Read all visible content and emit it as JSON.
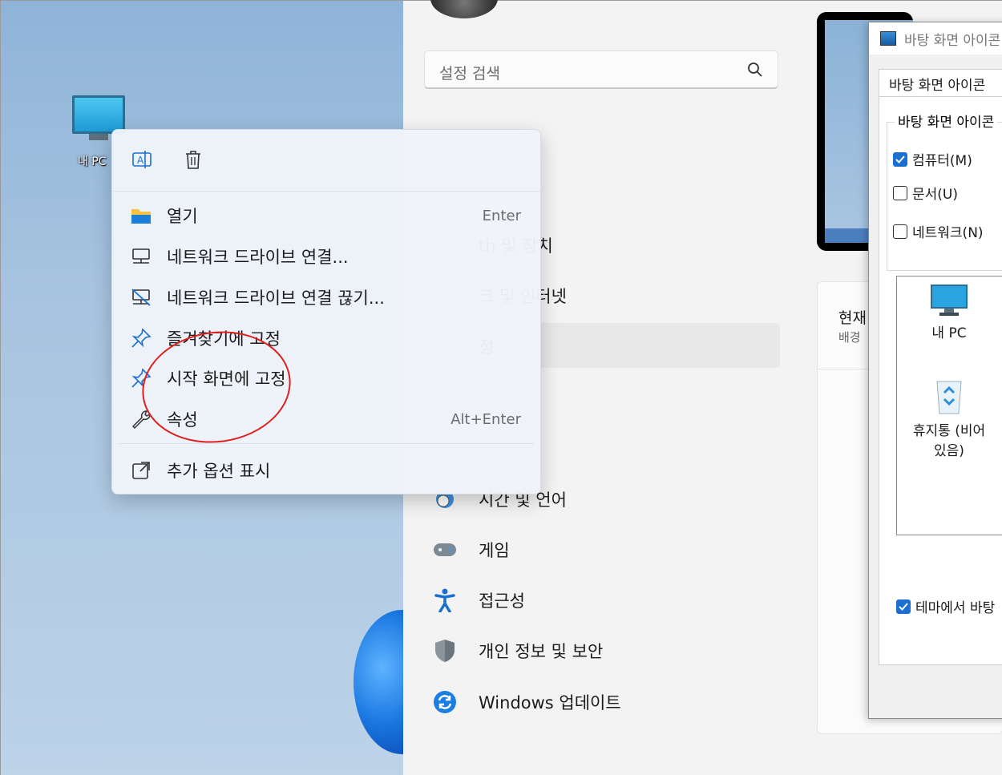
{
  "desktop": {
    "icon_label": "내 PC"
  },
  "settings": {
    "search_placeholder": "설정 검색",
    "nav": [
      {
        "label": "th 및 장치",
        "icon": "bluetooth-icon"
      },
      {
        "label": "크 및 인터넷",
        "icon": "network-icon"
      },
      {
        "label": "정",
        "icon": "personalization-icon"
      },
      {
        "label": "시간 및 언어",
        "icon": "time-language-icon"
      },
      {
        "label": "게임",
        "icon": "gaming-icon"
      },
      {
        "label": "접근성",
        "icon": "accessibility-icon"
      },
      {
        "label": "개인 정보 및 보안",
        "icon": "shield-icon"
      },
      {
        "label": "Windows 업데이트",
        "icon": "update-icon"
      }
    ],
    "card_title": "현재",
    "card_subtitle": "배경"
  },
  "dialog": {
    "title": "바탕 화면 아이콘",
    "tab": "바탕 화면 아이콘",
    "group_title": "바탕 화면 아이콘",
    "checkboxes": [
      {
        "label": "컴퓨터(M)",
        "checked": true
      },
      {
        "label": "문서(U)",
        "checked": false
      },
      {
        "label": "네트워크(N)",
        "checked": false
      }
    ],
    "icons": [
      {
        "label": "내 PC"
      },
      {
        "label": "휴지통 (비어 있음)"
      }
    ],
    "theme_checkbox": {
      "label": "테마에서 바탕",
      "checked": true
    }
  },
  "context_menu": {
    "top_actions": [
      {
        "name": "rename",
        "icon": "rename-icon"
      },
      {
        "name": "delete",
        "icon": "trash-icon"
      }
    ],
    "items": [
      {
        "label": "열기",
        "shortcut": "Enter",
        "icon": "folder-icon"
      },
      {
        "label": "네트워크 드라이브 연결...",
        "shortcut": "",
        "icon": "network-drive-icon"
      },
      {
        "label": "네트워크 드라이브 연결 끊기...",
        "shortcut": "",
        "icon": "disconnect-drive-icon"
      },
      {
        "label": "즐겨찾기에 고정",
        "shortcut": "",
        "icon": "pin-icon"
      },
      {
        "label": "시작 화면에 고정",
        "shortcut": "",
        "icon": "pin-icon"
      },
      {
        "label": "속성",
        "shortcut": "Alt+Enter",
        "icon": "wrench-icon"
      }
    ],
    "more_options": {
      "label": "추가 옵션 표시",
      "icon": "more-options-icon"
    }
  },
  "colors": {
    "accent": "#1a6fd1",
    "highlight_circle": "#e01f1f"
  }
}
